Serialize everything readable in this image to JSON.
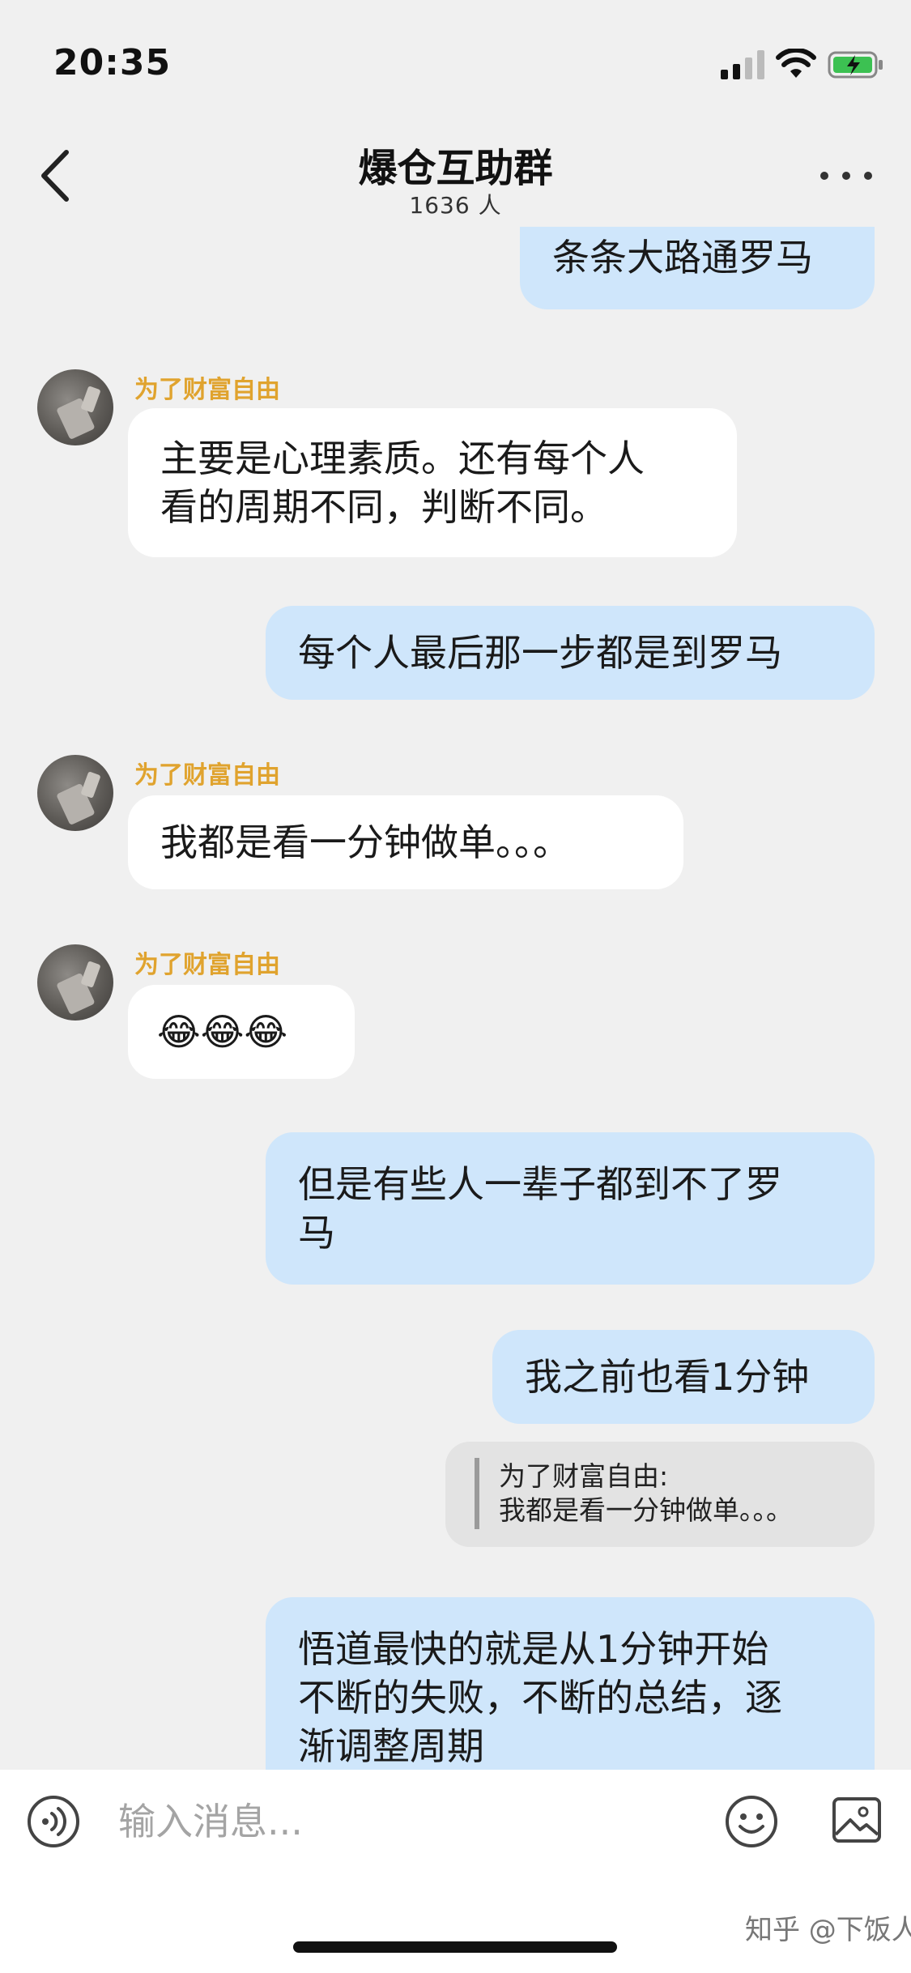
{
  "status_bar": {
    "time": "20:35"
  },
  "header": {
    "title": "爆仓互助群",
    "member_count": "1636 人"
  },
  "messages": [
    {
      "direction": "out",
      "text": "条条大路通罗马"
    },
    {
      "direction": "in",
      "sender": "为了财富自由",
      "lines": [
        "主要是心理素质。还有每个人",
        "看的周期不同，判断不同。"
      ]
    },
    {
      "direction": "out",
      "text": "每个人最后那一步都是到罗马"
    },
    {
      "direction": "in",
      "sender": "为了财富自由",
      "text": "我都是看一分钟做单。。。"
    },
    {
      "direction": "in",
      "sender": "为了财富自由",
      "text": "😂😂😂"
    },
    {
      "direction": "out",
      "lines": [
        "但是有些人一辈子都到不了罗",
        "马"
      ]
    },
    {
      "direction": "out",
      "text": "我之前也看1分钟"
    },
    {
      "direction": "quote",
      "quote_author": "为了财富自由:",
      "quote_text": "我都是看一分钟做单。。。"
    },
    {
      "direction": "out",
      "lines": [
        "悟道最快的就是从1分钟开始",
        "不断的失败，不断的总结，逐",
        "渐调整周期"
      ]
    }
  ],
  "input": {
    "placeholder": "输入消息..."
  },
  "watermark": "知乎 @下饭人",
  "colors": {
    "out_bubble": "#cfe6fb",
    "in_bubble": "#ffffff",
    "sender_name": "#e0a32e",
    "background": "#f0f0f0"
  }
}
